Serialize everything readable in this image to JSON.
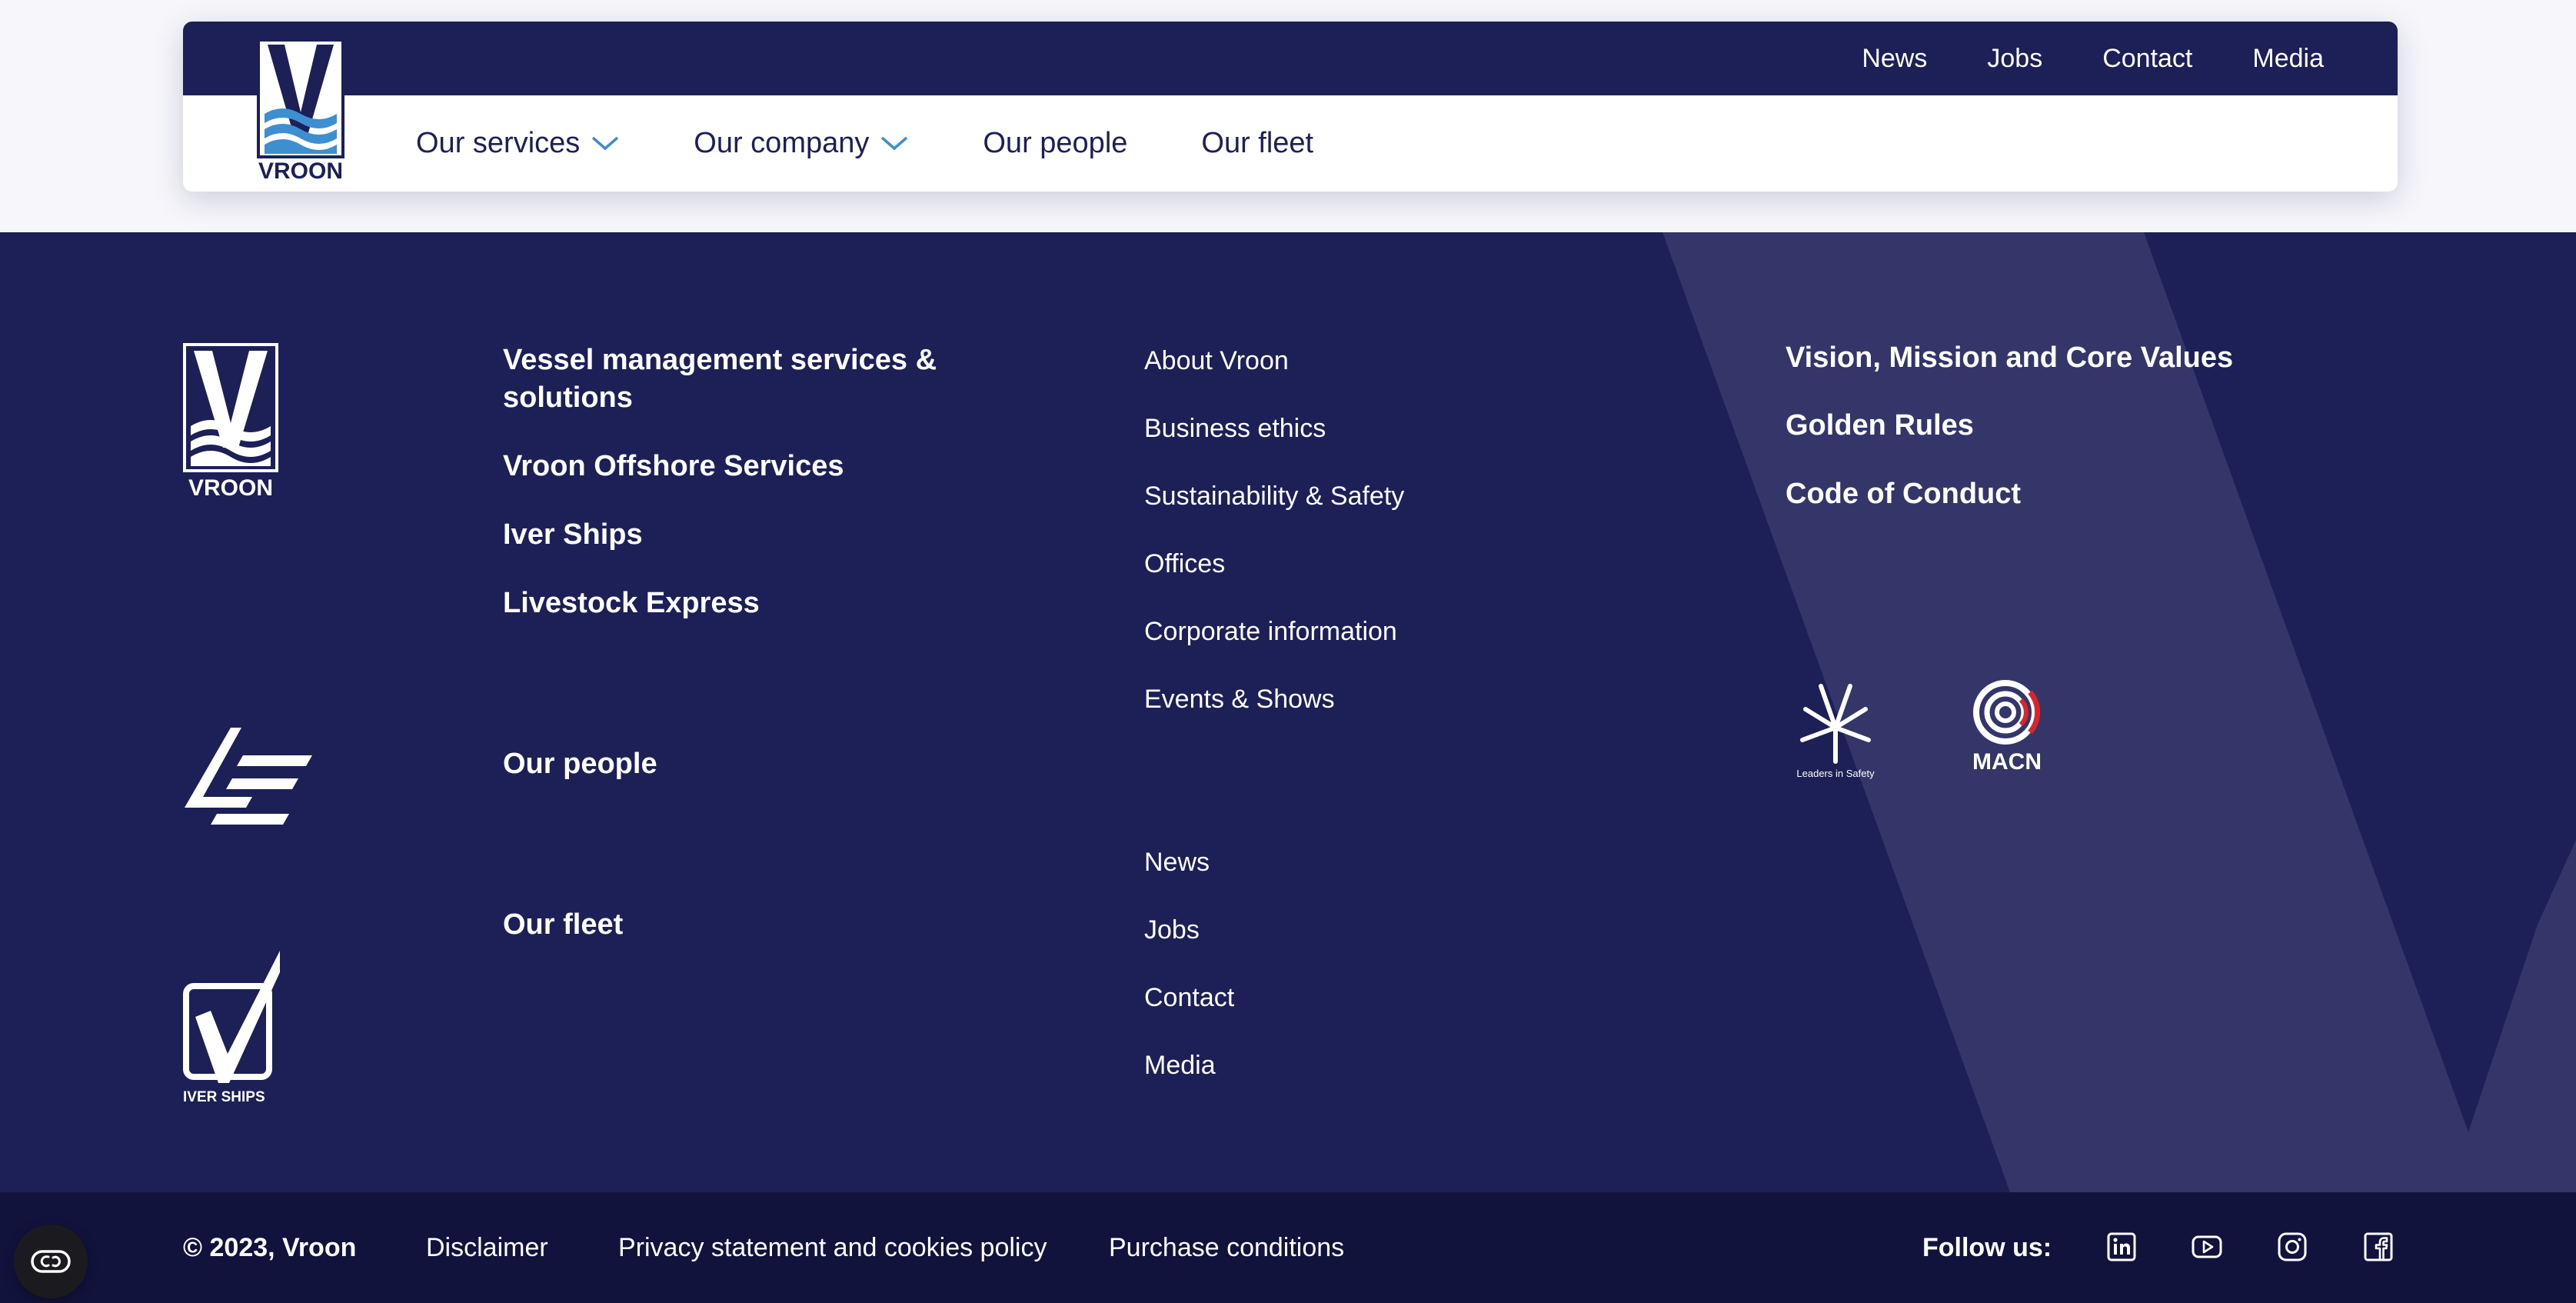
{
  "header": {
    "logo_text": "VROON",
    "top_nav": [
      "News",
      "Jobs",
      "Contact",
      "Media"
    ],
    "main_nav": [
      {
        "label": "Our services",
        "has_dropdown": true
      },
      {
        "label": "Our company",
        "has_dropdown": true
      },
      {
        "label": "Our people",
        "has_dropdown": false
      },
      {
        "label": "Our fleet",
        "has_dropdown": false
      }
    ]
  },
  "footer": {
    "brand_logos": [
      "VROON",
      "IVER SHIPS"
    ],
    "services_links": [
      "Vessel management services & solutions",
      "Vroon Offshore Services",
      "Iver Ships",
      "Livestock Express",
      "Our people",
      "Our fleet"
    ],
    "company_links": [
      "About Vroon",
      "Business ethics",
      "Sustainability & Safety",
      "Offices",
      "Corporate information",
      "Events & Shows",
      "News",
      "Jobs",
      "Contact",
      "Media"
    ],
    "values_links": [
      "Vision, Mission and Core Values",
      "Golden Rules",
      "Code of Conduct"
    ],
    "badges": [
      "Leaders in Safety",
      "MACN"
    ]
  },
  "bottombar": {
    "copyright": "© 2023, Vroon",
    "links": [
      "Disclaimer",
      "Privacy statement and cookies policy",
      "Purchase conditions"
    ],
    "follow_label": "Follow us:",
    "social_icons": [
      "linkedin-icon",
      "youtube-icon",
      "instagram-icon",
      "facebook-icon"
    ]
  },
  "colors": {
    "navy": "#1d1f57",
    "bottom_navy": "#12133d",
    "accent_blue": "#3d8fd0",
    "macn_red": "#d7262d"
  }
}
